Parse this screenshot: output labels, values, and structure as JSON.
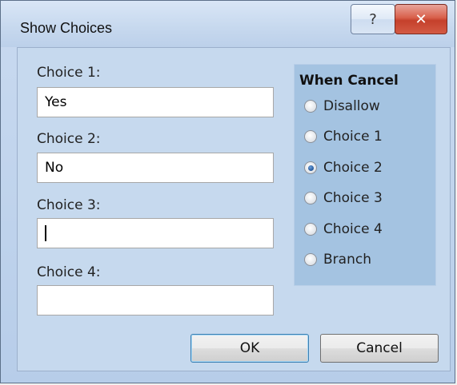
{
  "window": {
    "title": "Show Choices",
    "help_glyph": "?",
    "close_glyph": "✕"
  },
  "choices": [
    {
      "label": "Choice 1:",
      "value": "Yes"
    },
    {
      "label": "Choice 2:",
      "value": "No"
    },
    {
      "label": "Choice 3:",
      "value": ""
    },
    {
      "label": "Choice 4:",
      "value": ""
    }
  ],
  "when_cancel": {
    "title": "When Cancel",
    "options": [
      "Disallow",
      "Choice 1",
      "Choice 2",
      "Choice 3",
      "Choice 4",
      "Branch"
    ],
    "selected": "Choice 2"
  },
  "buttons": {
    "ok": "OK",
    "cancel": "Cancel"
  },
  "colors": {
    "panel": "#c6d9ee",
    "group": "#a4c3e1",
    "close": "#c5402b"
  }
}
